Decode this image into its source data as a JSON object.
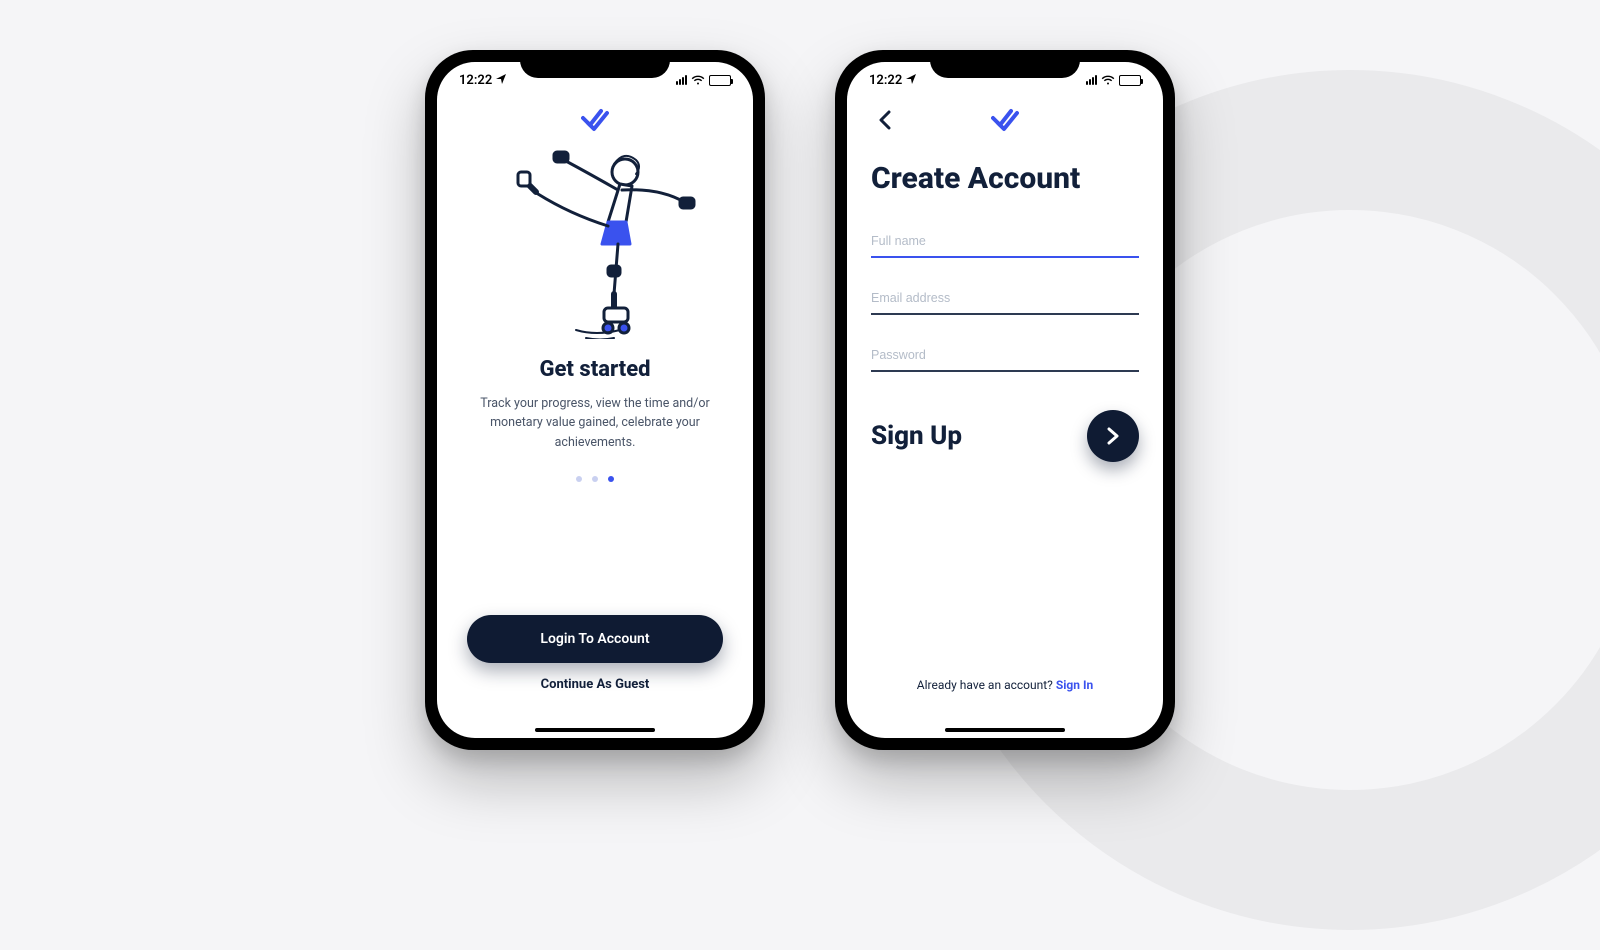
{
  "colors": {
    "accent": "#3a52ee",
    "dark": "#0f1b33"
  },
  "status": {
    "time": "12:22"
  },
  "screen1": {
    "title": "Get started",
    "description": "Track your progress, view the time and/or monetary value gained, celebrate your achievements.",
    "login_button": "Login To Account",
    "guest_link": "Continue As Guest",
    "page_dots": {
      "count": 3,
      "active_index": 2
    }
  },
  "screen2": {
    "title": "Create Account",
    "fields": {
      "fullname": {
        "placeholder": "Full name",
        "value": ""
      },
      "email": {
        "placeholder": "Email address",
        "value": ""
      },
      "password": {
        "placeholder": "Password",
        "value": ""
      }
    },
    "signup_label": "Sign Up",
    "footer_prompt": "Already have an account? ",
    "footer_link": "Sign In"
  }
}
